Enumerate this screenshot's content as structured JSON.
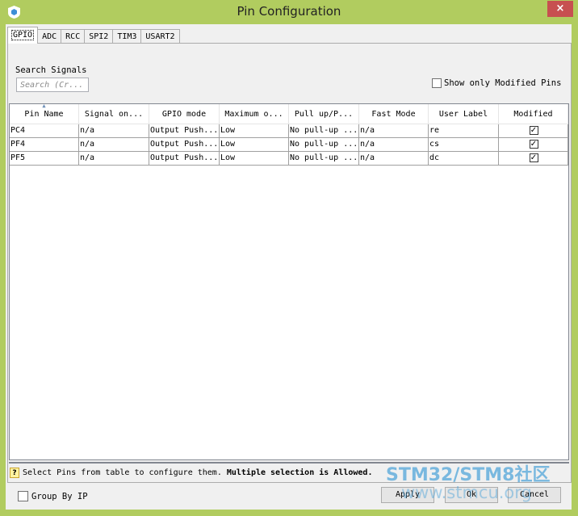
{
  "window": {
    "title": "Pin Configuration",
    "close_glyph": "×"
  },
  "tabs": [
    {
      "label": "GPIO",
      "active": true
    },
    {
      "label": "ADC",
      "active": false
    },
    {
      "label": "RCC",
      "active": false
    },
    {
      "label": "SPI2",
      "active": false
    },
    {
      "label": "TIM3",
      "active": false
    },
    {
      "label": "USART2",
      "active": false
    }
  ],
  "search": {
    "label": "Search Signals",
    "placeholder": "Search (Cr..."
  },
  "show_modified": {
    "label": "Show only Modified Pins",
    "checked": false
  },
  "table": {
    "sort_indicator": "▲",
    "columns": [
      "Pin Name",
      "Signal on...",
      "GPIO mode",
      "Maximum o...",
      "Pull up/P...",
      "Fast Mode",
      "User Label",
      "Modified"
    ],
    "rows": [
      {
        "pin": "PC4",
        "signal": "n/a",
        "gpio_mode": "Output Push...",
        "max_output": "Low",
        "pull": "No pull-up ...",
        "fast_mode": "n/a",
        "user_label": "re",
        "modified": true
      },
      {
        "pin": "PF4",
        "signal": "n/a",
        "gpio_mode": "Output Push...",
        "max_output": "Low",
        "pull": "No pull-up ...",
        "fast_mode": "n/a",
        "user_label": "cs",
        "modified": true
      },
      {
        "pin": "PF5",
        "signal": "n/a",
        "gpio_mode": "Output Push...",
        "max_output": "Low",
        "pull": "No pull-up ...",
        "fast_mode": "n/a",
        "user_label": "dc",
        "modified": true
      }
    ]
  },
  "status": {
    "icon": "?",
    "text": "Select Pins from table to configure them.",
    "bold_text": "Multiple selection is Allowed."
  },
  "group_by_ip": {
    "label": "Group By IP",
    "checked": false
  },
  "buttons": {
    "apply": "Apply",
    "ok": "Ok",
    "cancel": "Cancel"
  },
  "watermark": {
    "line1": "STM32/STM8社区",
    "line2": "www.stmcu.org"
  }
}
